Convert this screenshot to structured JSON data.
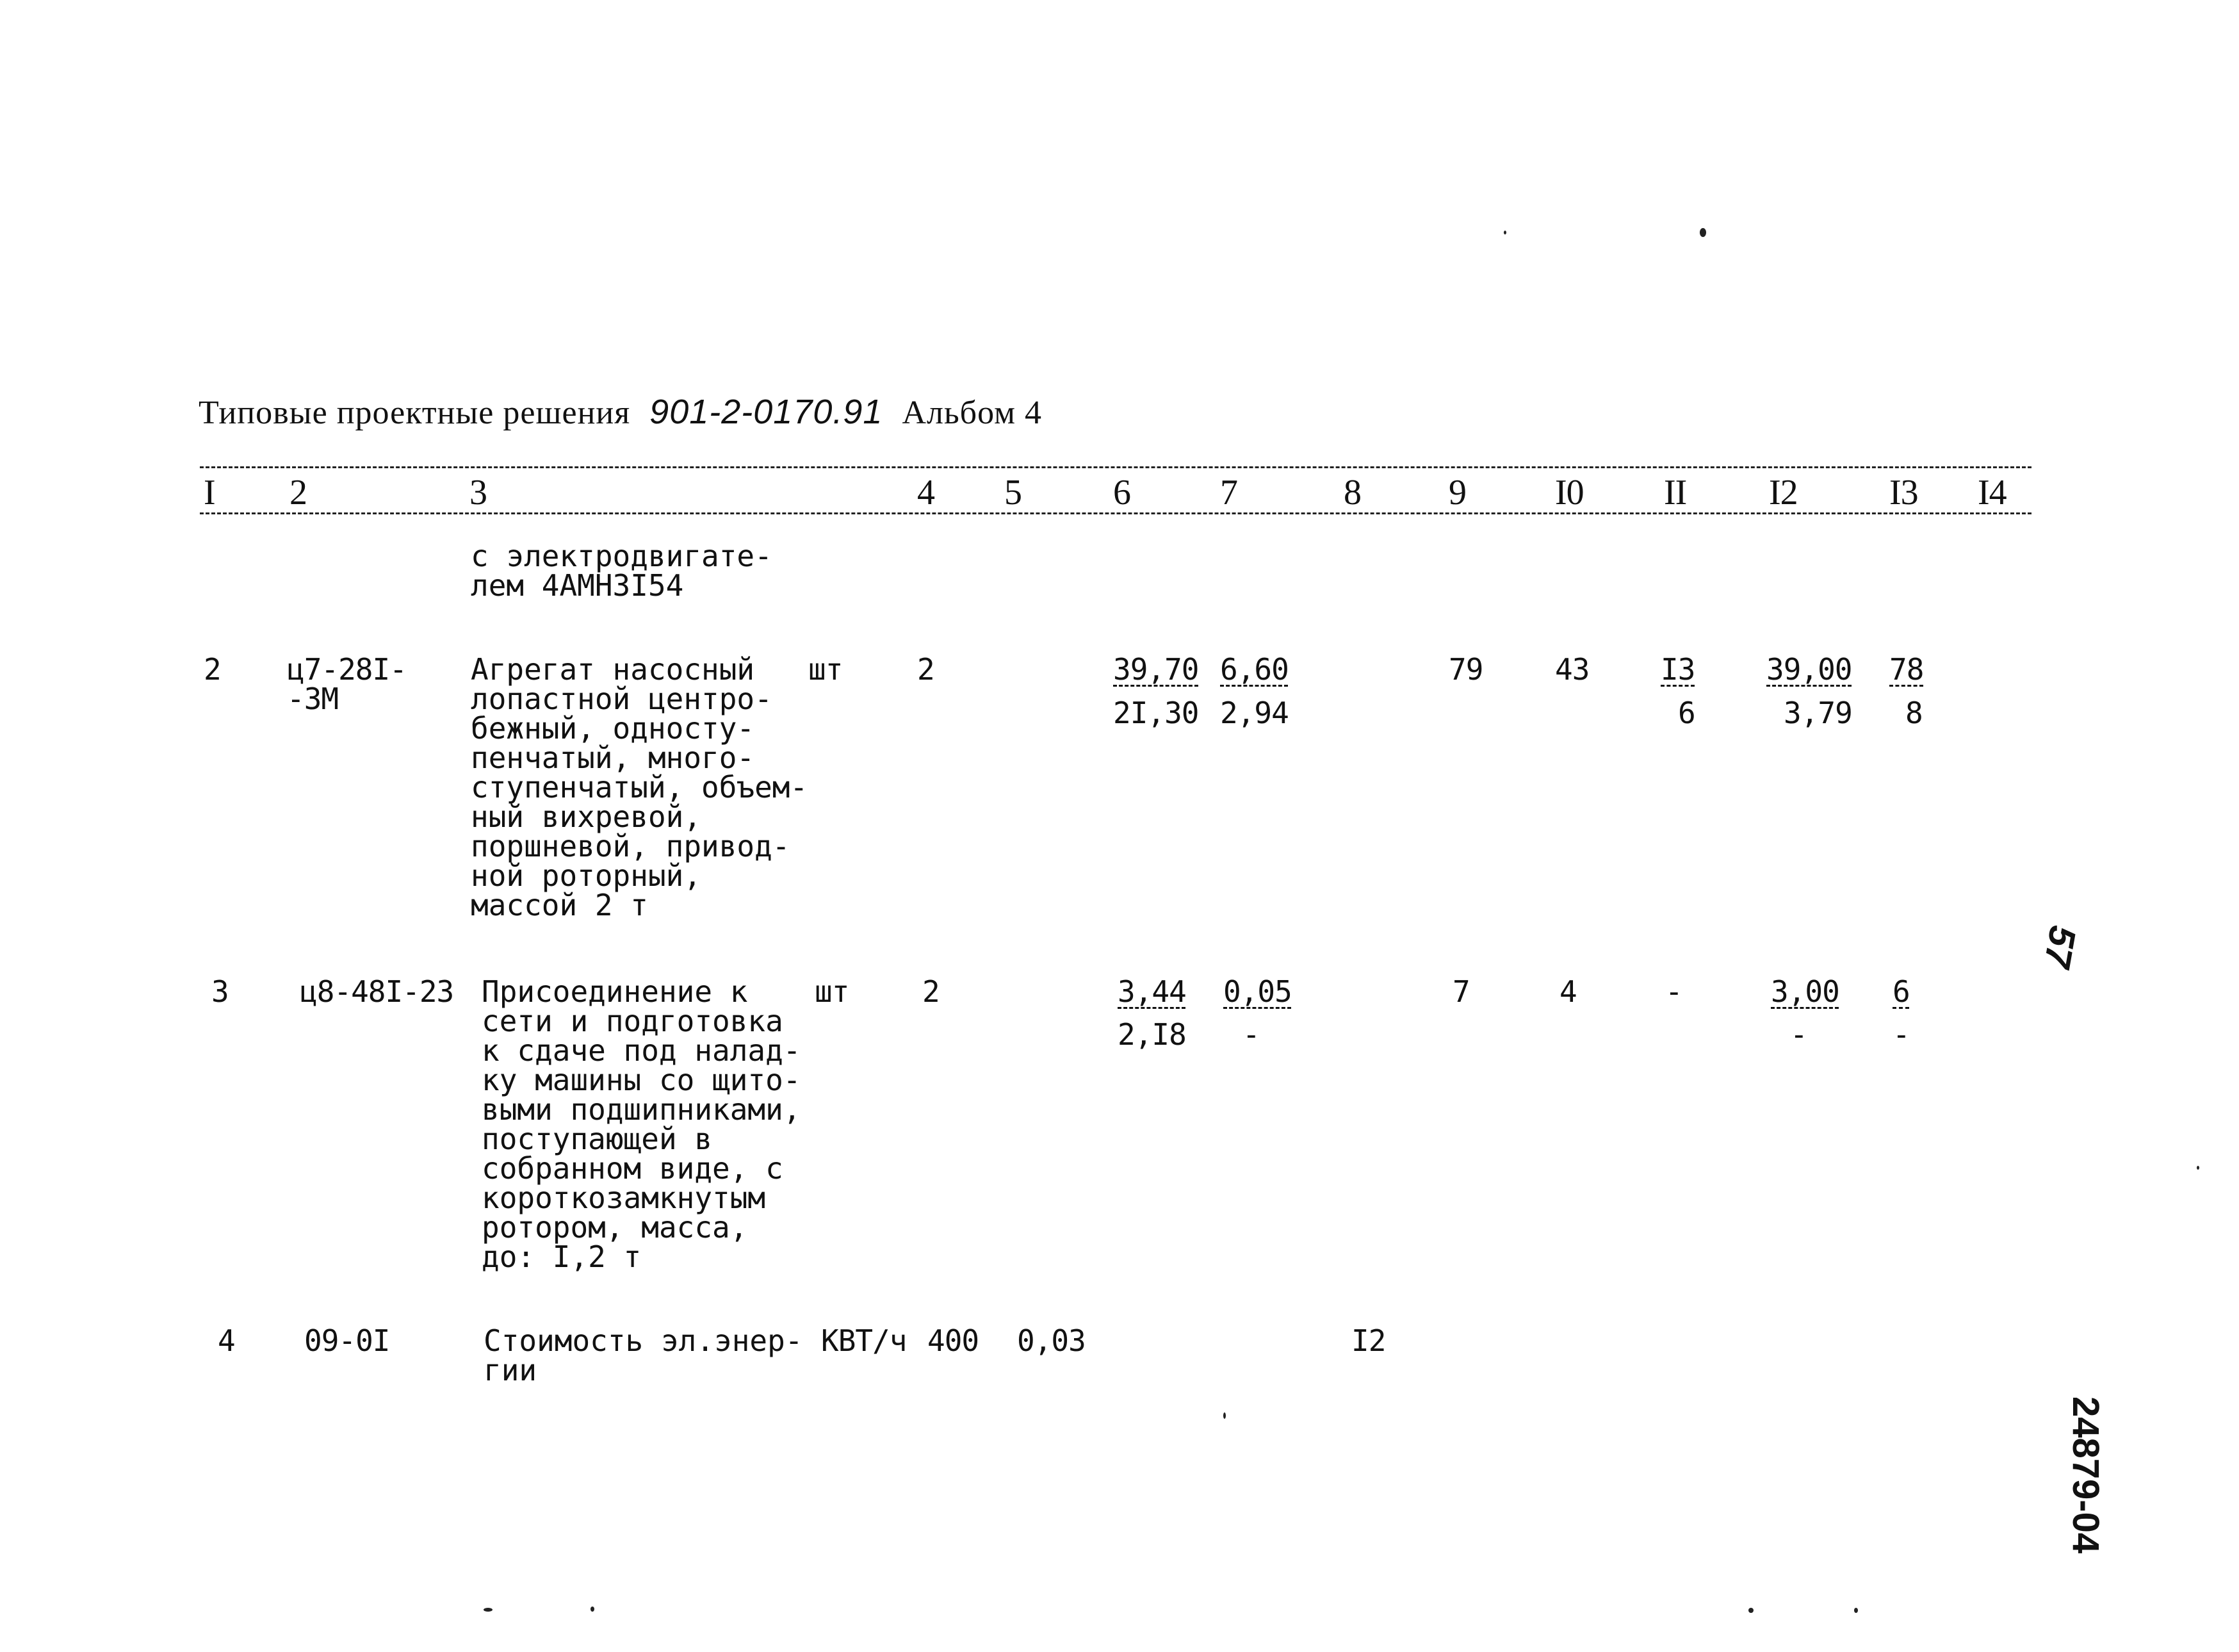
{
  "header": {
    "title_prefix": "Типовые проектные решения",
    "project_code": "901-2-0170.91",
    "album": "Альбом 4"
  },
  "columns": [
    "I",
    "2",
    "3",
    "4",
    "5",
    "6",
    "7",
    "8",
    "9",
    "I0",
    "II",
    "I2",
    "I3",
    "I4"
  ],
  "continuation": {
    "description": "с электродвигате-\nлем 4АМН3I54"
  },
  "rows": [
    {
      "num": "2",
      "code": "ц7-28I-\n-3М",
      "description": "Агрегат насосный\nлопастной центро-\nбежный, односту-\nпенчатый, много-\nступенчатый, объем-\nный вихревой,\nпоршневой, привод-\nной роторный,\nмассой 2 т",
      "unit": "шт",
      "qty": "2",
      "col5": "",
      "col6_top": "39,70",
      "col6_bottom": "2I,30",
      "col7_top": "6,60",
      "col7_bottom": "2,94",
      "col8": "",
      "col9": "79",
      "col10": "43",
      "col11_top": "I3",
      "col11_bottom": "6",
      "col12_top": "39,00",
      "col12_bottom": "3,79",
      "col13_top": "78",
      "col13_bottom": "8"
    },
    {
      "num": "3",
      "code": "ц8-48I-23",
      "description": "Присоединение к\nсети и подготовка\nк сдаче под налад-\nку машины со щито-\nвыми подшипниками,\nпоступающей в\nсобранном виде, с\nкороткозамкнутым\nротором, масса,\nдо: I,2 т",
      "unit": "шт",
      "qty": "2",
      "col5": "",
      "col6_top": "3,44",
      "col6_bottom": "2,I8",
      "col7_top": "0,05",
      "col7_bottom": "-",
      "col8": "",
      "col9": "7",
      "col10": "4",
      "col11_top": "-",
      "col11_bottom": "",
      "col12_top": "3,00",
      "col12_bottom": "-",
      "col13_top": "6",
      "col13_bottom": "-"
    },
    {
      "num": "4",
      "code": "09-0I",
      "description": "Стоимость эл.энер-\nгии",
      "unit": "КВТ/ч",
      "qty": "400",
      "col5": "0,03",
      "col8": "I2"
    }
  ],
  "margin_notes": {
    "page_number_handwritten": "57",
    "archive_stamp": "24879-04"
  }
}
